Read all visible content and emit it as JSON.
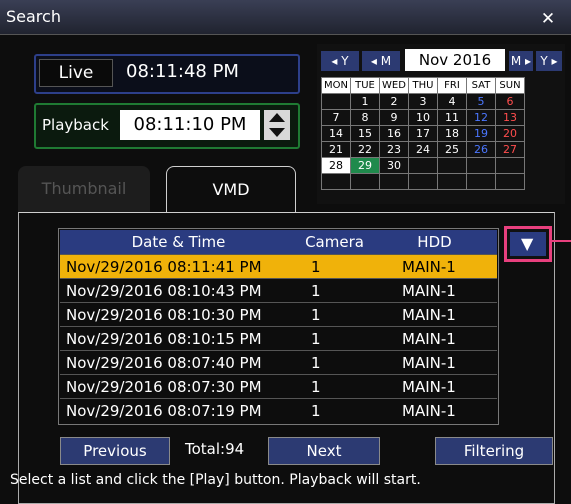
{
  "window": {
    "title": "Search",
    "close_glyph": "✕"
  },
  "live": {
    "label": "Live",
    "time": "08:11:48 PM"
  },
  "playback": {
    "label": "Playback",
    "time": "08:11:10 PM"
  },
  "calendar": {
    "nav": {
      "prev_year": "◂ Y",
      "prev_month": "◂ M",
      "month": "Nov 2016",
      "next_month": "M ▸",
      "next_year": "Y ▸"
    },
    "weekdays": [
      "MON",
      "TUE",
      "WED",
      "THU",
      "FRI",
      "SAT",
      "SUN"
    ],
    "weeks": [
      [
        "",
        "1",
        "2",
        "3",
        "4",
        "5",
        "6"
      ],
      [
        "7",
        "8",
        "9",
        "10",
        "11",
        "12",
        "13"
      ],
      [
        "14",
        "15",
        "16",
        "17",
        "18",
        "19",
        "20"
      ],
      [
        "21",
        "22",
        "23",
        "24",
        "25",
        "26",
        "27"
      ],
      [
        "28",
        "29",
        "30",
        "",
        "",
        "",
        ""
      ],
      [
        "",
        "",
        "",
        "",
        "",
        "",
        ""
      ]
    ],
    "selected_day": "29",
    "current_day": "28",
    "colors": {
      "saturday": "#4b77ff",
      "sunday": "#ff4d4d",
      "selected": "#1f8a4c"
    }
  },
  "tabs": [
    {
      "label": "Thumbnail",
      "active": false
    },
    {
      "label": "VMD",
      "active": true
    }
  ],
  "list": {
    "headers": [
      "Date & Time",
      "Camera",
      "HDD"
    ],
    "rows": [
      [
        "Nov/29/2016  08:11:41 PM",
        "1",
        "MAIN-1"
      ],
      [
        "Nov/29/2016  08:10:43 PM",
        "1",
        "MAIN-1"
      ],
      [
        "Nov/29/2016  08:10:30 PM",
        "1",
        "MAIN-1"
      ],
      [
        "Nov/29/2016  08:10:15 PM",
        "1",
        "MAIN-1"
      ],
      [
        "Nov/29/2016  08:07:40 PM",
        "1",
        "MAIN-1"
      ],
      [
        "Nov/29/2016  08:07:30 PM",
        "1",
        "MAIN-1"
      ],
      [
        "Nov/29/2016  08:07:19 PM",
        "1",
        "MAIN-1"
      ]
    ],
    "selected_row": 0,
    "dropdown_icon": "chevron-down-icon"
  },
  "footer": {
    "previous_label": "Previous",
    "total": "Total:94",
    "next_label": "Next",
    "filtering_label": "Filtering",
    "hint": "Select a list and click the [Play] button. Playback will start."
  },
  "colors": {
    "highlight": "#f0b20a",
    "accent": "#2a3b80",
    "callout": "#e8407e"
  }
}
